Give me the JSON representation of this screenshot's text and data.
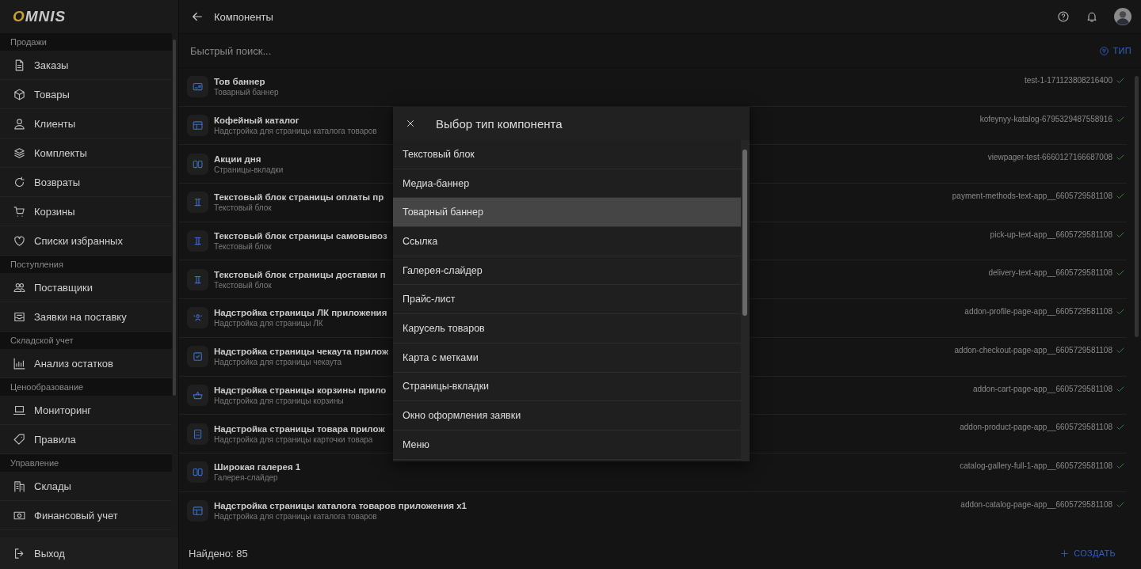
{
  "logo": [
    "O",
    "MNIS"
  ],
  "sidebar": {
    "sections": [
      {
        "title": "Продажи",
        "items": [
          "Заказы",
          "Товары",
          "Клиенты",
          "Комплекты",
          "Возвраты",
          "Корзины",
          "Списки избранных"
        ]
      },
      {
        "title": "Поступления",
        "items": [
          "Поставщики",
          "Заявки на поставку"
        ]
      },
      {
        "title": "Складской учет",
        "items": [
          "Анализ остатков"
        ]
      },
      {
        "title": "Ценообразование",
        "items": [
          "Мониторинг",
          "Правила"
        ]
      },
      {
        "title": "Управление",
        "items": [
          "Склады",
          "Финансовый учет"
        ]
      }
    ],
    "logout": "Выход"
  },
  "header": {
    "title": "Компоненты"
  },
  "search": {
    "placeholder": "Быстрый поиск..."
  },
  "filter_button": "ТИП",
  "rows": [
    {
      "title": "Тов баннер",
      "subtitle": "Товарный баннер",
      "slug": "test-1-171123808216400",
      "kind": "banner",
      "active": true
    },
    {
      "title": "Кофейный каталог",
      "subtitle": "Надстройка для страницы каталога товаров",
      "slug": "kofeynyy-katalog-6795329487558916",
      "kind": "layout",
      "active": true
    },
    {
      "title": "Акции дня",
      "subtitle": "Страницы-вкладки",
      "slug": "viewpager-test-6660127166687008",
      "kind": "columns",
      "active": true
    },
    {
      "title": "Текстовый блок страницы оплаты пр",
      "subtitle": "Текстовый блок",
      "slug": "payment-methods-text-app__6605729581108",
      "kind": "text",
      "active": true
    },
    {
      "title": "Текстовый блок страницы самовывоз",
      "subtitle": "Текстовый блок",
      "slug": "pick-up-text-app__6605729581108",
      "kind": "text",
      "active": true
    },
    {
      "title": "Текстовый блок страницы доставки п",
      "subtitle": "Текстовый блок",
      "slug": "delivery-text-app__6605729581108",
      "kind": "text",
      "active": true
    },
    {
      "title": "Надстройка страницы ЛК приложения",
      "subtitle": "Надстройка для страницы ЛК",
      "slug": "addon-profile-page-app__6605729581108",
      "kind": "profile",
      "active": true
    },
    {
      "title": "Надстройка страницы чекаута прилож",
      "subtitle": "Надстройка для страницы чекаута",
      "slug": "addon-checkout-page-app__6605729581108",
      "kind": "checkout",
      "active": true
    },
    {
      "title": "Надстройка страницы корзины прило",
      "subtitle": "Надстройка для страницы корзины",
      "slug": "addon-cart-page-app__6605729581108",
      "kind": "basket",
      "active": true
    },
    {
      "title": "Надстройка страницы товара прилож",
      "subtitle": "Надстройка для страницы карточки товара",
      "slug": "addon-product-page-app__6605729581108",
      "kind": "product",
      "active": true
    },
    {
      "title": "Широкая галерея 1",
      "subtitle": "Галерея-слайдер",
      "slug": "catalog-gallery-full-1-app__6605729581108",
      "kind": "columns",
      "active": true
    },
    {
      "title": "Надстройка страницы каталога товаров приложения x1",
      "subtitle": "Надстройка для страницы каталога товаров",
      "slug": "addon-catalog-page-app__6605729581108",
      "kind": "layout",
      "active": true
    }
  ],
  "footer": {
    "count": "Найдено: 85",
    "create_button": "СОЗДАТЬ"
  },
  "dialog": {
    "title": "Выбор тип компонента",
    "options": [
      {
        "label": "Текстовый блок",
        "selected": false
      },
      {
        "label": "Медиа-баннер",
        "selected": false
      },
      {
        "label": "Товарный баннер",
        "selected": true
      },
      {
        "label": "Ссылка",
        "selected": false
      },
      {
        "label": "Галерея-слайдер",
        "selected": false
      },
      {
        "label": "Прайс-лист",
        "selected": false
      },
      {
        "label": "Карусель товаров",
        "selected": false
      },
      {
        "label": "Карта с метками",
        "selected": false
      },
      {
        "label": "Страницы-вкладки",
        "selected": false
      },
      {
        "label": "Окно оформления заявки",
        "selected": false
      },
      {
        "label": "Меню",
        "selected": false
      }
    ]
  }
}
